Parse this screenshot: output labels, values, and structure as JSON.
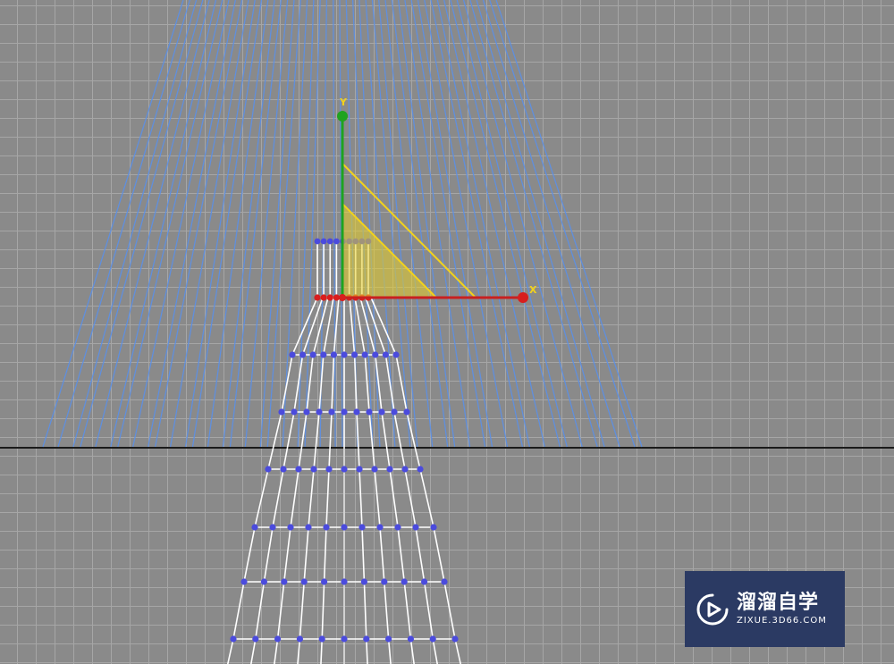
{
  "viewport": {
    "axis_labels": {
      "x": "X",
      "y": "Y"
    },
    "colors": {
      "background": "#8a8a8a",
      "grid": "#a6a6a6",
      "light_cone": "#5b8fe6",
      "mesh": "#ffffff",
      "vertex": "#4b4bdd",
      "gizmo_x": "#d81e1e",
      "gizmo_y": "#1fa31f",
      "plane_handle": "#f2d21c"
    }
  },
  "watermark": {
    "title": "溜溜自学",
    "url": "ZIXUE.3D66.COM",
    "logo_icon": "play-icon"
  }
}
